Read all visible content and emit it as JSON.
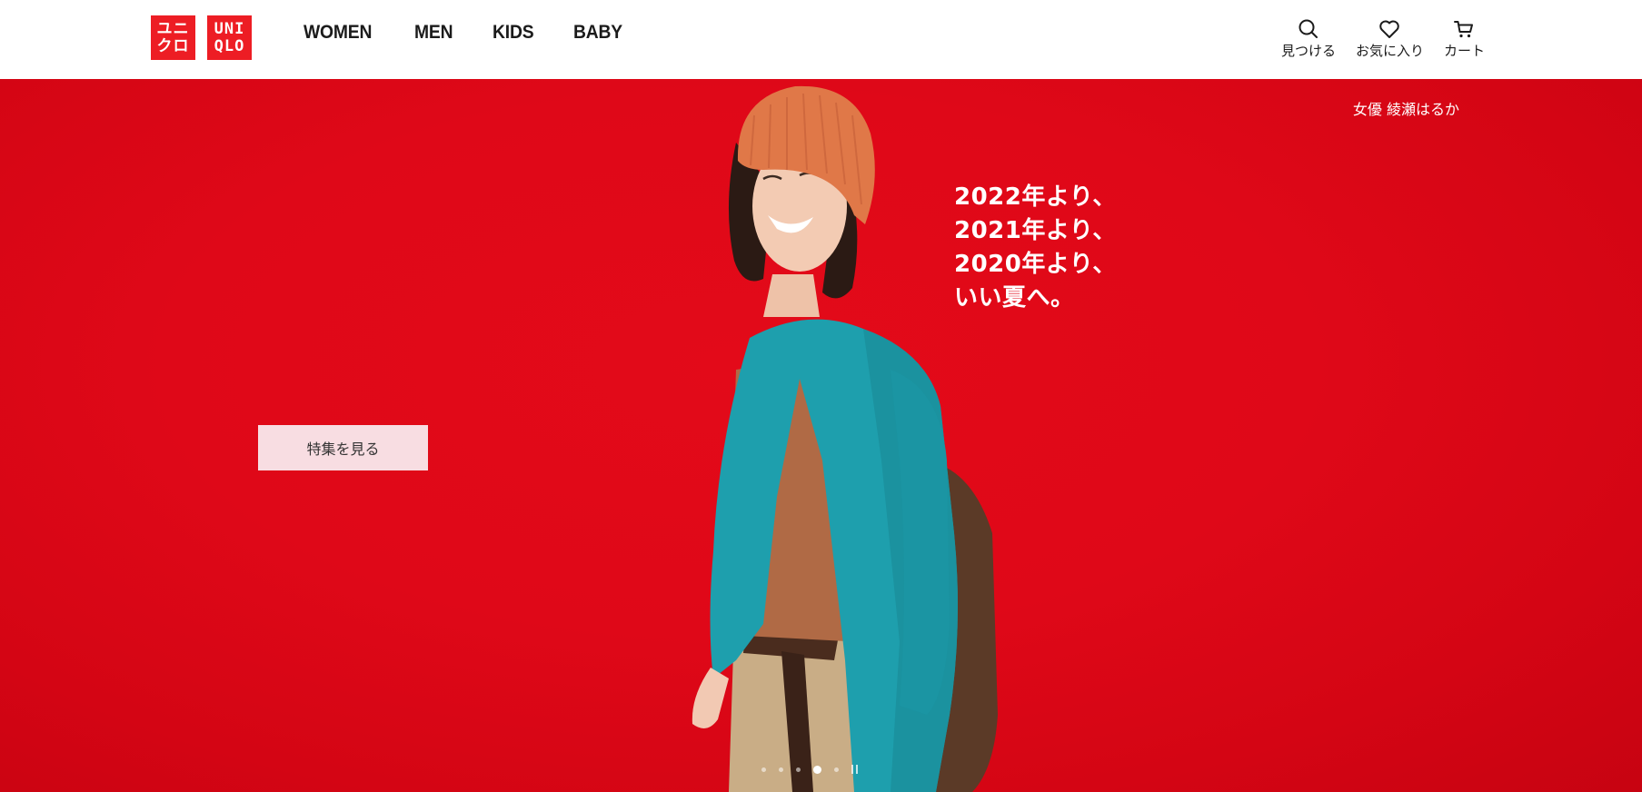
{
  "header": {
    "logo": {
      "top_left": [
        "ユニ",
        "クロ"
      ],
      "top_right": [
        "UNI",
        "QLO"
      ]
    },
    "nav": [
      "WOMEN",
      "MEN",
      "KIDS",
      "BABY"
    ],
    "utilities": [
      {
        "icon": "search-icon",
        "label": "見つける"
      },
      {
        "icon": "heart-icon",
        "label": "お気に入り"
      },
      {
        "icon": "cart-icon",
        "label": "カート"
      }
    ]
  },
  "hero": {
    "credit": "女優 綾瀬はるか",
    "headline": [
      "2022年より、",
      "2021年より、",
      "2020年より、",
      "いい夏へ。"
    ],
    "cta_label": "特集を見る",
    "carousel": {
      "slides": 5,
      "active_index": 3
    },
    "colors": {
      "background": "#e00a18",
      "cta_bg": "#f8dde2",
      "brand": "#ed1d24"
    }
  }
}
